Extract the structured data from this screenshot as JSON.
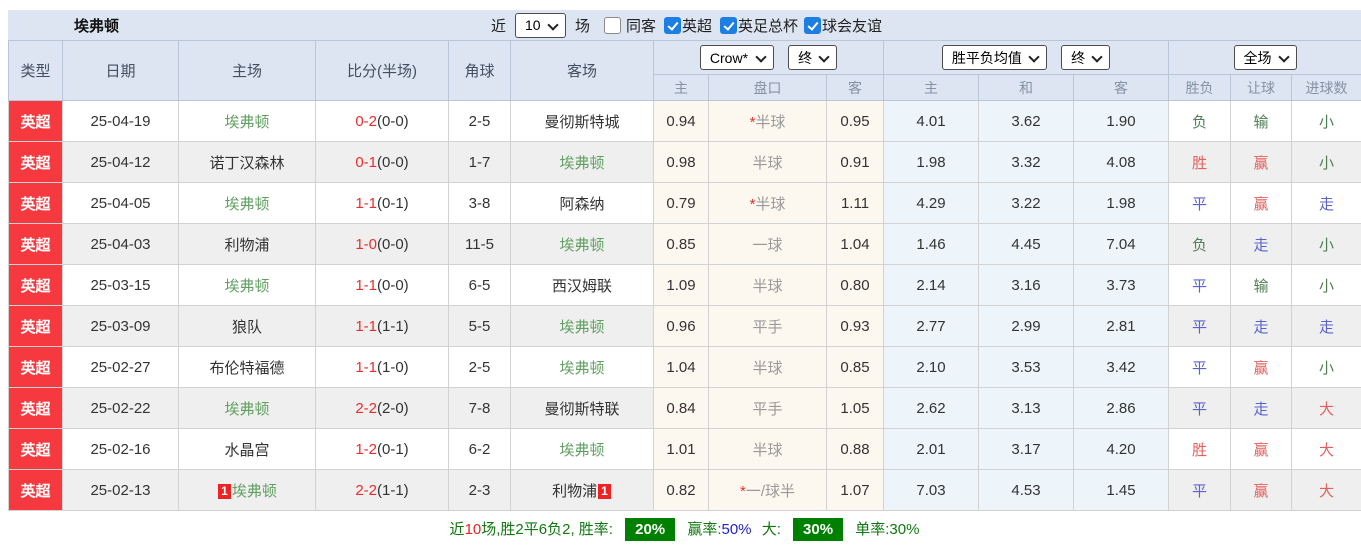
{
  "header": {
    "team_title": "埃弗顿",
    "recent_label": "近",
    "recent_value": "10",
    "matches_label": "场",
    "filters": [
      {
        "label": "同客",
        "checked": false
      },
      {
        "label": "英超",
        "checked": true
      },
      {
        "label": "英足总杯",
        "checked": true
      },
      {
        "label": "球会友谊",
        "checked": true
      }
    ]
  },
  "table": {
    "columns": {
      "type": "类型",
      "date": "日期",
      "home": "主场",
      "score": "比分(半场)",
      "corners": "角球",
      "away": "客场"
    },
    "selectors": {
      "company": "Crow*",
      "company_time": "终",
      "europe": "胜平负均值",
      "europe_time": "终",
      "scope": "全场"
    },
    "sub_headers": [
      "主",
      "盘口",
      "客",
      "主",
      "和",
      "客",
      "胜负",
      "让球",
      "进球数"
    ],
    "rows": [
      {
        "league": "英超",
        "date": "25-04-19",
        "home": "埃弗顿",
        "home_color": "tgreen",
        "home_card": "",
        "score": "0-2",
        "half": "(0-0)",
        "corners": "2-5",
        "away": "曼彻斯特城",
        "away_color": "",
        "away_card": "",
        "ah_home": "0.94",
        "ah_star": "*",
        "ah_line": "半球",
        "ah_away": "0.95",
        "eu_home": "4.01",
        "eu_draw": "3.62",
        "eu_away": "1.90",
        "result": "负",
        "result_color": "green",
        "ah_result": "输",
        "ah_result_color": "green",
        "goals": "小",
        "goals_color": "green"
      },
      {
        "league": "英超",
        "date": "25-04-12",
        "home": "诺丁汉森林",
        "home_color": "",
        "home_card": "",
        "score": "0-1",
        "half": "(0-0)",
        "corners": "1-7",
        "away": "埃弗顿",
        "away_color": "tgreen",
        "away_card": "",
        "ah_home": "0.98",
        "ah_star": "",
        "ah_line": "半球",
        "ah_away": "0.91",
        "eu_home": "1.98",
        "eu_draw": "3.32",
        "eu_away": "4.08",
        "result": "胜",
        "result_color": "red",
        "ah_result": "赢",
        "ah_result_color": "red",
        "goals": "小",
        "goals_color": "green"
      },
      {
        "league": "英超",
        "date": "25-04-05",
        "home": "埃弗顿",
        "home_color": "tgreen",
        "home_card": "",
        "score": "1-1",
        "half": "(0-1)",
        "corners": "3-8",
        "away": "阿森纳",
        "away_color": "",
        "away_card": "",
        "ah_home": "0.79",
        "ah_star": "*",
        "ah_line": "半球",
        "ah_away": "1.11",
        "eu_home": "4.29",
        "eu_draw": "3.22",
        "eu_away": "1.98",
        "result": "平",
        "result_color": "blue",
        "ah_result": "赢",
        "ah_result_color": "red",
        "goals": "走",
        "goals_color": "blue"
      },
      {
        "league": "英超",
        "date": "25-04-03",
        "home": "利物浦",
        "home_color": "",
        "home_card": "",
        "score": "1-0",
        "half": "(0-0)",
        "corners": "11-5",
        "away": "埃弗顿",
        "away_color": "tgreen",
        "away_card": "",
        "ah_home": "0.85",
        "ah_star": "",
        "ah_line": "一球",
        "ah_away": "1.04",
        "eu_home": "1.46",
        "eu_draw": "4.45",
        "eu_away": "7.04",
        "result": "负",
        "result_color": "green",
        "ah_result": "走",
        "ah_result_color": "blue",
        "goals": "小",
        "goals_color": "green"
      },
      {
        "league": "英超",
        "date": "25-03-15",
        "home": "埃弗顿",
        "home_color": "tgreen",
        "home_card": "",
        "score": "1-1",
        "half": "(0-0)",
        "corners": "6-5",
        "away": "西汉姆联",
        "away_color": "",
        "away_card": "",
        "ah_home": "1.09",
        "ah_star": "",
        "ah_line": "半球",
        "ah_away": "0.80",
        "eu_home": "2.14",
        "eu_draw": "3.16",
        "eu_away": "3.73",
        "result": "平",
        "result_color": "blue",
        "ah_result": "输",
        "ah_result_color": "green",
        "goals": "小",
        "goals_color": "green"
      },
      {
        "league": "英超",
        "date": "25-03-09",
        "home": "狼队",
        "home_color": "",
        "home_card": "",
        "score": "1-1",
        "half": "(1-1)",
        "corners": "5-5",
        "away": "埃弗顿",
        "away_color": "tgreen",
        "away_card": "",
        "ah_home": "0.96",
        "ah_star": "",
        "ah_line": "平手",
        "ah_away": "0.93",
        "eu_home": "2.77",
        "eu_draw": "2.99",
        "eu_away": "2.81",
        "result": "平",
        "result_color": "blue",
        "ah_result": "走",
        "ah_result_color": "blue",
        "goals": "走",
        "goals_color": "blue"
      },
      {
        "league": "英超",
        "date": "25-02-27",
        "home": "布伦特福德",
        "home_color": "",
        "home_card": "",
        "score": "1-1",
        "half": "(1-0)",
        "corners": "2-5",
        "away": "埃弗顿",
        "away_color": "tgreen",
        "away_card": "",
        "ah_home": "1.04",
        "ah_star": "",
        "ah_line": "半球",
        "ah_away": "0.85",
        "eu_home": "2.10",
        "eu_draw": "3.53",
        "eu_away": "3.42",
        "result": "平",
        "result_color": "blue",
        "ah_result": "赢",
        "ah_result_color": "red",
        "goals": "小",
        "goals_color": "green"
      },
      {
        "league": "英超",
        "date": "25-02-22",
        "home": "埃弗顿",
        "home_color": "tgreen",
        "home_card": "",
        "score": "2-2",
        "half": "(2-0)",
        "corners": "7-8",
        "away": "曼彻斯特联",
        "away_color": "",
        "away_card": "",
        "ah_home": "0.84",
        "ah_star": "",
        "ah_line": "平手",
        "ah_away": "1.05",
        "eu_home": "2.62",
        "eu_draw": "3.13",
        "eu_away": "2.86",
        "result": "平",
        "result_color": "blue",
        "ah_result": "走",
        "ah_result_color": "blue",
        "goals": "大",
        "goals_color": "red"
      },
      {
        "league": "英超",
        "date": "25-02-16",
        "home": "水晶宫",
        "home_color": "",
        "home_card": "",
        "score": "1-2",
        "half": "(0-1)",
        "corners": "6-2",
        "away": "埃弗顿",
        "away_color": "tgreen",
        "away_card": "",
        "ah_home": "1.01",
        "ah_star": "",
        "ah_line": "半球",
        "ah_away": "0.88",
        "eu_home": "2.01",
        "eu_draw": "3.17",
        "eu_away": "4.20",
        "result": "胜",
        "result_color": "red",
        "ah_result": "赢",
        "ah_result_color": "red",
        "goals": "大",
        "goals_color": "red"
      },
      {
        "league": "英超",
        "date": "25-02-13",
        "home": "埃弗顿",
        "home_color": "tgreen",
        "home_card": "1",
        "score": "2-2",
        "half": "(1-1)",
        "corners": "2-3",
        "away": "利物浦",
        "away_color": "",
        "away_card": "1",
        "ah_home": "0.82",
        "ah_star": "*",
        "ah_line": "一/球半",
        "ah_away": "1.07",
        "eu_home": "7.03",
        "eu_draw": "4.53",
        "eu_away": "1.45",
        "result": "平",
        "result_color": "blue",
        "ah_result": "赢",
        "ah_result_color": "red",
        "goals": "大",
        "goals_color": "red"
      }
    ]
  },
  "footer": {
    "near_label": "近",
    "near_count": "10",
    "summary": "场,胜2平6负2, 胜率:",
    "win_rate": "20%",
    "handicap_label": "赢率:",
    "handicap_rate": "50%",
    "big_label": "大:",
    "big_rate": "30%",
    "single_label": "单率:",
    "single_rate": "30%"
  }
}
